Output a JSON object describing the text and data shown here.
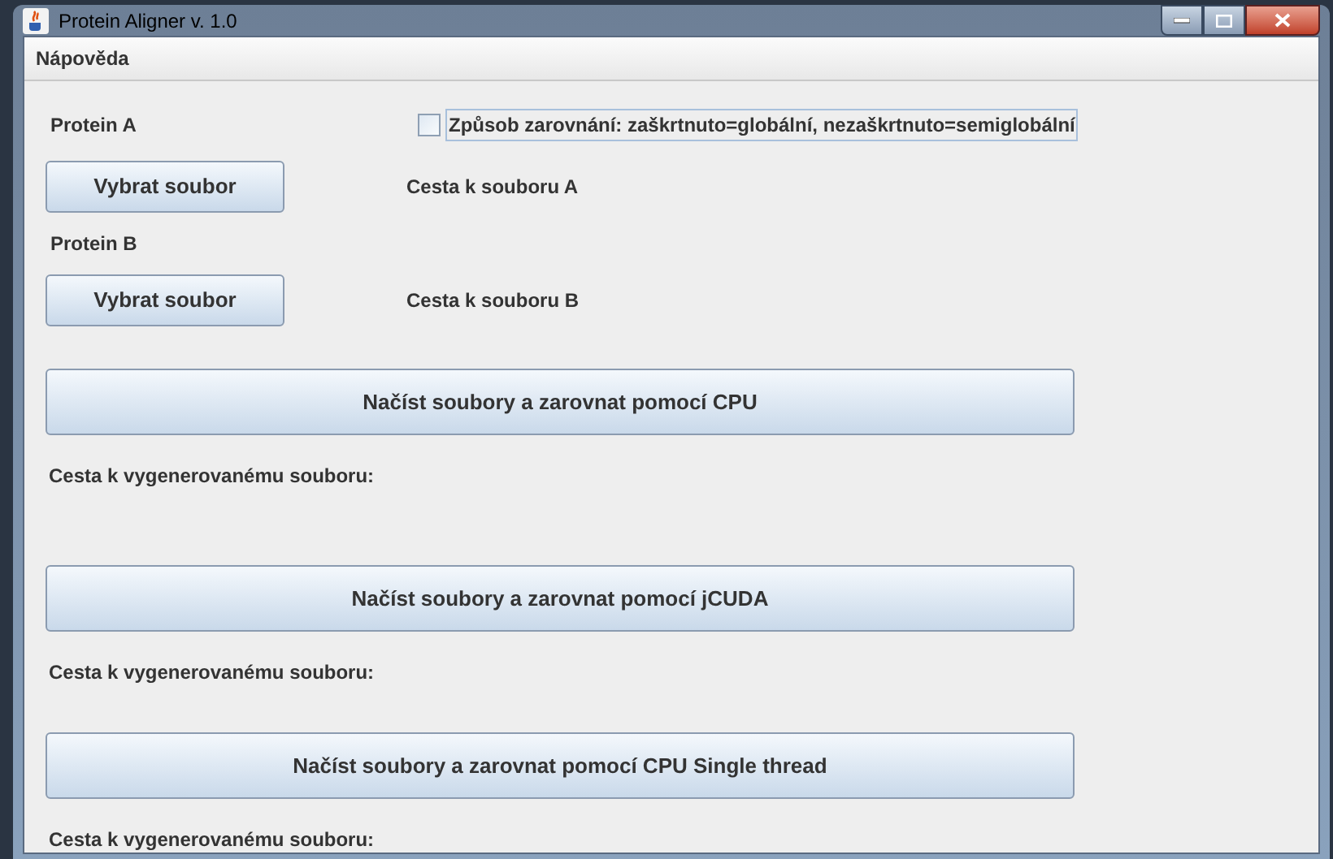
{
  "window": {
    "title": "Protein Aligner v. 1.0"
  },
  "menu": [
    {
      "label": "Nápověda"
    }
  ],
  "protein_a": {
    "label": "Protein A",
    "button": "Vybrat soubor",
    "path": "Cesta k souboru A"
  },
  "alignment_checkbox": {
    "label": "Způsob zarovnání: zaškrtnuto=globální, nezaškrtnuto=semiglobální",
    "checked": false
  },
  "protein_b": {
    "label": "Protein B",
    "button": "Vybrat soubor",
    "path": "Cesta k souboru B"
  },
  "actions": [
    {
      "button": "Načíst soubory a zarovnat pomocí CPU",
      "output_label": "Cesta k vygenerovanému souboru:"
    },
    {
      "button": "Načíst soubory a zarovnat pomocí jCUDA",
      "output_label": "Cesta k vygenerovanému souboru:"
    },
    {
      "button": "Načíst soubory a zarovnat pomocí CPU Single thread",
      "output_label": "Cesta k vygenerovanému souboru:"
    }
  ]
}
